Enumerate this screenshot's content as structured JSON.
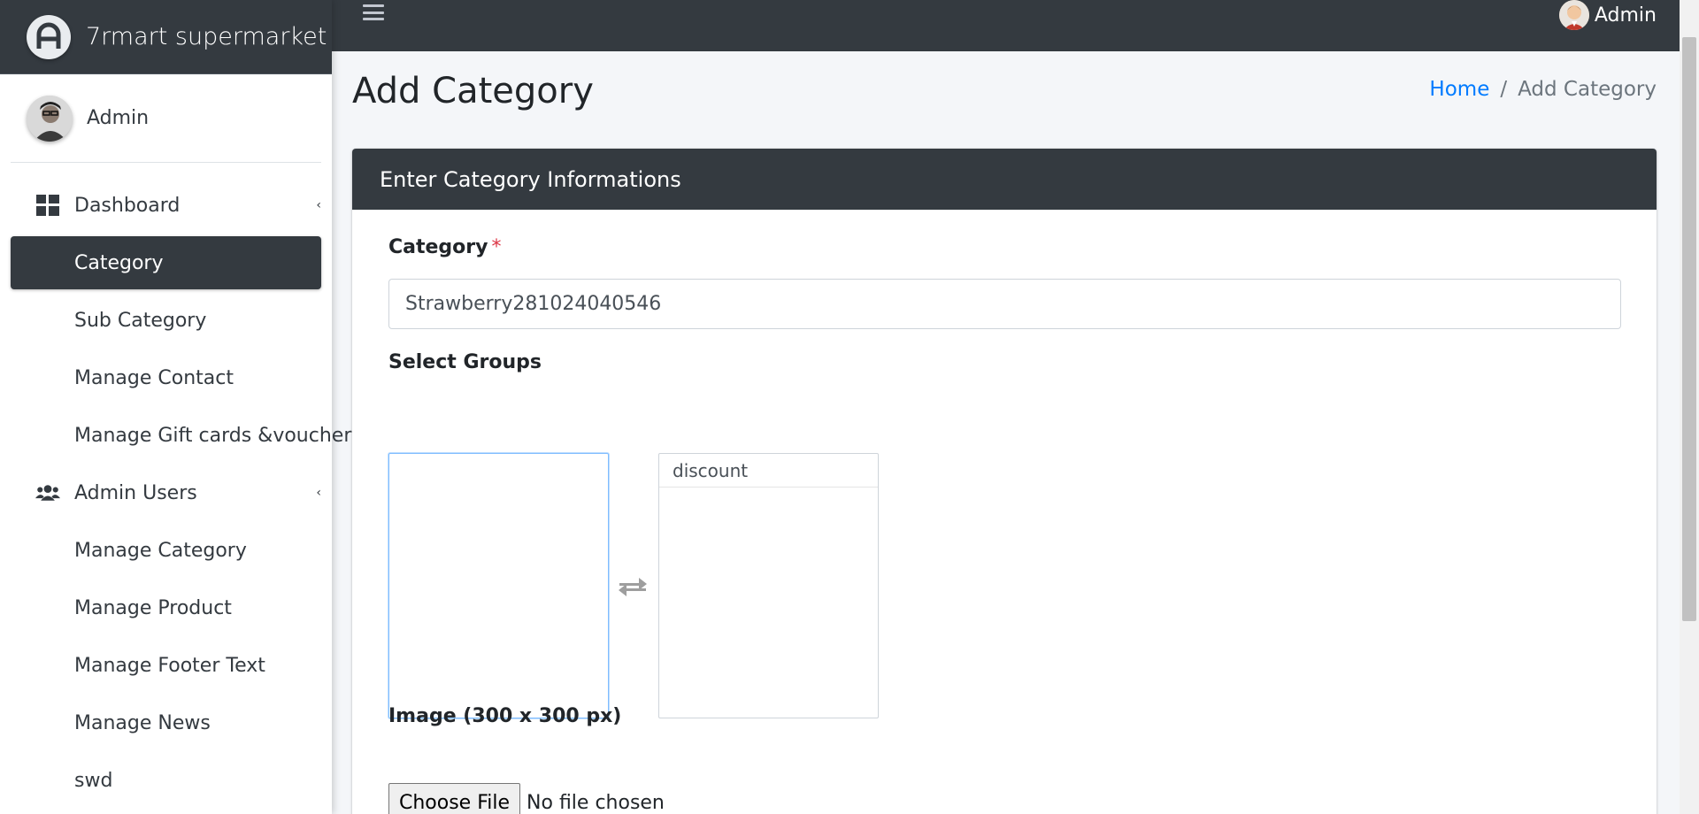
{
  "sidebar": {
    "brand": "7rmart supermarket",
    "user_name": "Admin",
    "items": [
      {
        "label": "Dashboard",
        "icon": "dashboard-icon",
        "active": false,
        "caret": true
      },
      {
        "label": "Category",
        "active": true
      },
      {
        "label": "Sub Category",
        "active": false
      },
      {
        "label": "Manage Contact",
        "active": false
      },
      {
        "label": "Manage Gift cards &voucher",
        "active": false
      },
      {
        "label": "Admin Users",
        "icon": "users-icon",
        "active": false,
        "caret": true
      },
      {
        "label": "Manage Category",
        "active": false
      },
      {
        "label": "Manage Product",
        "active": false
      },
      {
        "label": "Manage Footer Text",
        "active": false
      },
      {
        "label": "Manage News",
        "active": false
      },
      {
        "label": "swd",
        "active": false
      }
    ]
  },
  "topbar": {
    "menu_icon": "hamburger-icon",
    "user_name": "Admin"
  },
  "page": {
    "title": "Add Category",
    "breadcrumb": {
      "home": "Home",
      "current": "Add Category"
    }
  },
  "form": {
    "header": "Enter Category Informations",
    "category_label": "Category",
    "required_mark": "*",
    "category_value": "Strawberry281024040546",
    "groups_label": "Select Groups",
    "available_groups": [],
    "selected_groups": [
      "discount"
    ],
    "swap_icon": "swap-arrows-icon",
    "image_label": "Image (300 x 300 px)",
    "file_button": "Choose File",
    "file_status": "No file chosen"
  },
  "colors": {
    "dark": "#343a40",
    "link": "#007bff",
    "required": "#dc3545",
    "background": "#f4f6f9"
  }
}
